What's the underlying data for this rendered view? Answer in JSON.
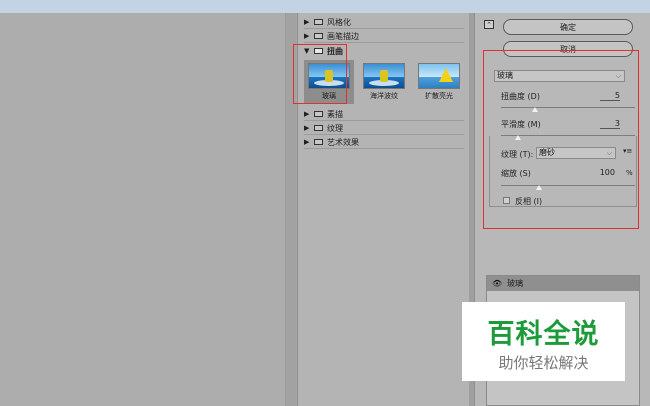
{
  "categories_before": [
    {
      "label": "风格化"
    },
    {
      "label": "画笔描边"
    }
  ],
  "open_category": "扭曲",
  "thumbnails": [
    {
      "label": "玻璃",
      "selected": true
    },
    {
      "label": "海洋波纹",
      "selected": false
    },
    {
      "label": "扩散亮光",
      "selected": false
    }
  ],
  "categories_after": [
    {
      "label": "素描"
    },
    {
      "label": "纹理"
    },
    {
      "label": "艺术效果"
    }
  ],
  "buttons": {
    "ok": "确定",
    "cancel": "取消"
  },
  "filter_select": "玻璃",
  "params": {
    "distortion": {
      "label": "扭曲度 (D)",
      "value": "5",
      "fraction": 0.25
    },
    "smoothness": {
      "label": "平滑度 (M)",
      "value": "3",
      "fraction": 0.13
    },
    "texture_label": "纹理 (T):",
    "texture_value": "磨砂",
    "scaling": {
      "label": "缩放 (S)",
      "value": "100",
      "unit": "%",
      "fraction": 0.28
    },
    "invert_label": "反相 (I)",
    "invert_checked": false
  },
  "layer": {
    "name": "玻璃"
  },
  "watermark": {
    "title": "百科全说",
    "subtitle": "助你轻松解决"
  },
  "colors": {
    "highlight": "#e03030",
    "watermark": "#1d9b3a"
  }
}
